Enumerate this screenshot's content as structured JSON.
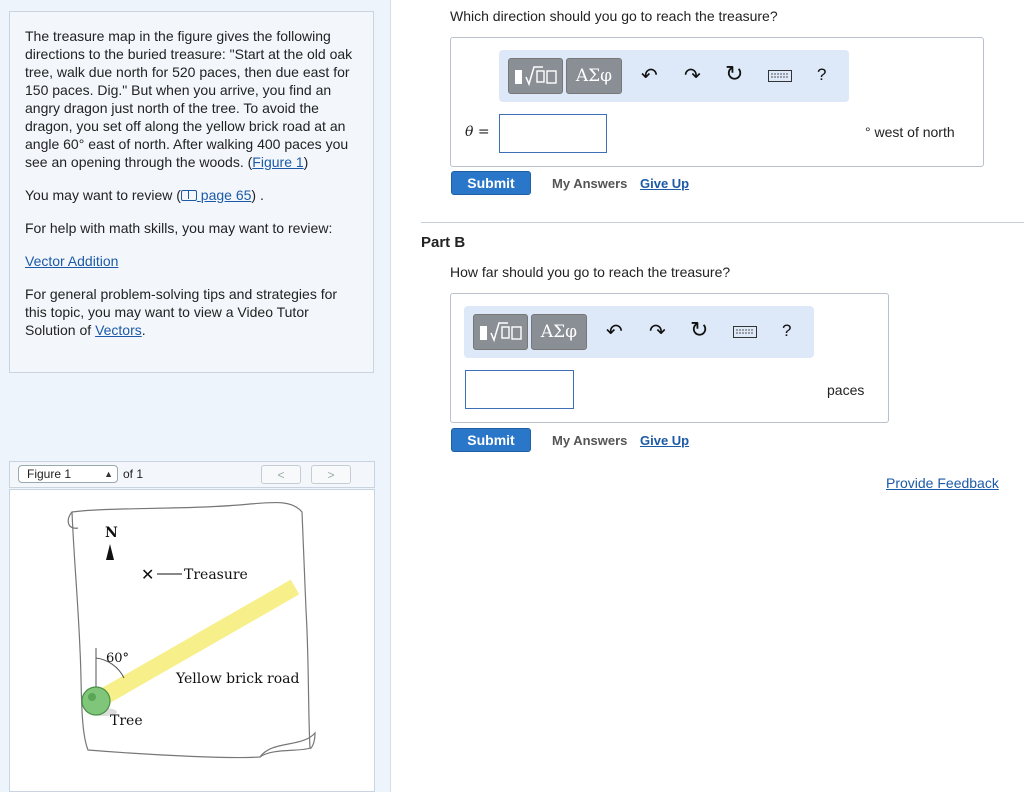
{
  "problem": {
    "text_main": "The treasure map in the figure gives the following directions to the buried treasure: \"Start at the old oak tree, walk due north for 520 paces, then due east for 150 paces. Dig.\" But when you arrive, you find an angry dragon just north of the tree. To avoid the dragon, you set off along the yellow brick road at an angle 60° east of north. After walking 400 paces you see an opening through the woods.",
    "figure_link_open": "(",
    "figure_link": "Figure 1",
    "figure_link_close": ")",
    "review_prefix": "You may want to review (",
    "review_link": "page 65",
    "review_suffix": ") .",
    "math_help": "For help with math skills, you may want to review:",
    "vector_link": "Vector Addition",
    "tips_text": "For general problem-solving tips and strategies for this topic, you may want to view a Video Tutor Solution of",
    "vectors_link": "Vectors",
    "tips_end": "."
  },
  "figure_nav": {
    "selected": "Figure 1",
    "of_label": "of 1",
    "prev": "<",
    "next": ">"
  },
  "figure": {
    "north": "N",
    "treasure": "Treasure",
    "angle": "60°",
    "road": "Yellow brick road",
    "tree": "Tree"
  },
  "partA": {
    "question": "Which direction should you go to reach the treasure?",
    "var_label": "θ =",
    "answer_value": "",
    "unit": "° west of north",
    "submit": "Submit",
    "my_answers": "My Answers",
    "give_up": "Give Up"
  },
  "partB": {
    "title": "Part B",
    "question": "How far should you go to reach the treasure?",
    "answer_value": "",
    "unit": "paces",
    "submit": "Submit",
    "my_answers": "My Answers",
    "give_up": "Give Up"
  },
  "toolbar": {
    "greek": "ΑΣφ",
    "help": "?"
  },
  "feedback": "Provide Feedback",
  "colors": {
    "accent": "#2a77c9",
    "link": "#1c5aa7",
    "road": "#f7ef8a"
  }
}
